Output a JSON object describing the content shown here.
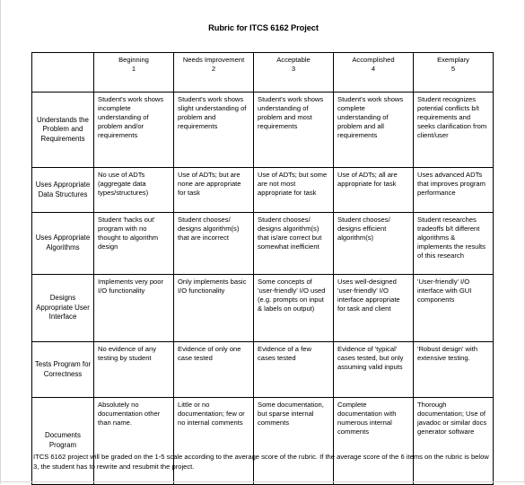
{
  "document": {
    "title": "Rubric for ITCS 6162 Project",
    "footnote": "ITCS 6162 project will be graded on the 1-5 scale according to the average score of the rubric. If the average score of the 6 items on the rubric is  below 3, the student has to rewrite and resubmit the project."
  },
  "table": {
    "corner_header": "",
    "levels": [
      {
        "name": "Beginning",
        "number": "1"
      },
      {
        "name": "Needs Improvement",
        "number": "2"
      },
      {
        "name": "Acceptable",
        "number": "3"
      },
      {
        "name": "Accomplished",
        "number": "4"
      },
      {
        "name": "Exemplary",
        "number": "5"
      }
    ],
    "rows": [
      {
        "criterion": "Understands the Problem and Requirements",
        "cells": [
          "Student's work shows incomplete understanding of problem and/or requirements",
          "Student's work shows slight understanding of problem and requirements",
          "Student's work shows understanding of problem and most requirements",
          "Student's work shows complete understanding of problem and all requirements",
          "Student recognizes potential conflicts b/t requirements and seeks clarification from client/user"
        ]
      },
      {
        "criterion": "Uses Appropriate Data Structures",
        "cells": [
          "No use of ADTs (aggregate data types/structures)",
          "Use of ADTs; but are none are appropriate for task",
          "Use of ADTs; but some are not most appropriate for task",
          "Use of ADTs; all are appropriate for task",
          "Uses advanced ADTs that improves program performance"
        ]
      },
      {
        "criterion": "Uses Appropriate Algorithms",
        "cells": [
          "Student 'hacks out' program with no thought to algorithm design",
          "Student chooses/ designs algorithm(s) that are incorrect",
          "Student chooses/ designs algorithm(s) that is/are correct but somewhat inefficient",
          "Student chooses/ designs efficient algorithm(s)",
          "Student researches tradeoffs b/t different algorithms & implements the results of this research"
        ]
      },
      {
        "criterion": "Designs Appropriate User Interface",
        "cells": [
          "Implements very poor  I/O functionality",
          "Only implements basic I/O functionality",
          "Some concepts of 'user-friendly' I/O used (e.g. prompts on input & labels on output)",
          "Uses well-designed 'user-friendly' I/O interface appropriate for task and client",
          "'User-friendly' I/O interface with GUI components"
        ]
      },
      {
        "criterion": "Tests Program for Correctness",
        "cells": [
          "No evidence of any testing by student",
          "Evidence of only one case tested",
          "Evidence of a few cases tested",
          "Evidence of 'typical' cases tested, but only assuming valid inputs",
          "'Robust design' with extensive testing."
        ]
      },
      {
        "criterion": "Documents Program",
        "cells": [
          "Absolutely no documentation other than name.",
          "Little or no documentation; few or no internal comments",
          "Some documentation, but sparse internal comments",
          "Complete documentation with numerous internal comments",
          "Thorough documentation; Use of javadoc or similar docs generator software"
        ]
      }
    ]
  }
}
